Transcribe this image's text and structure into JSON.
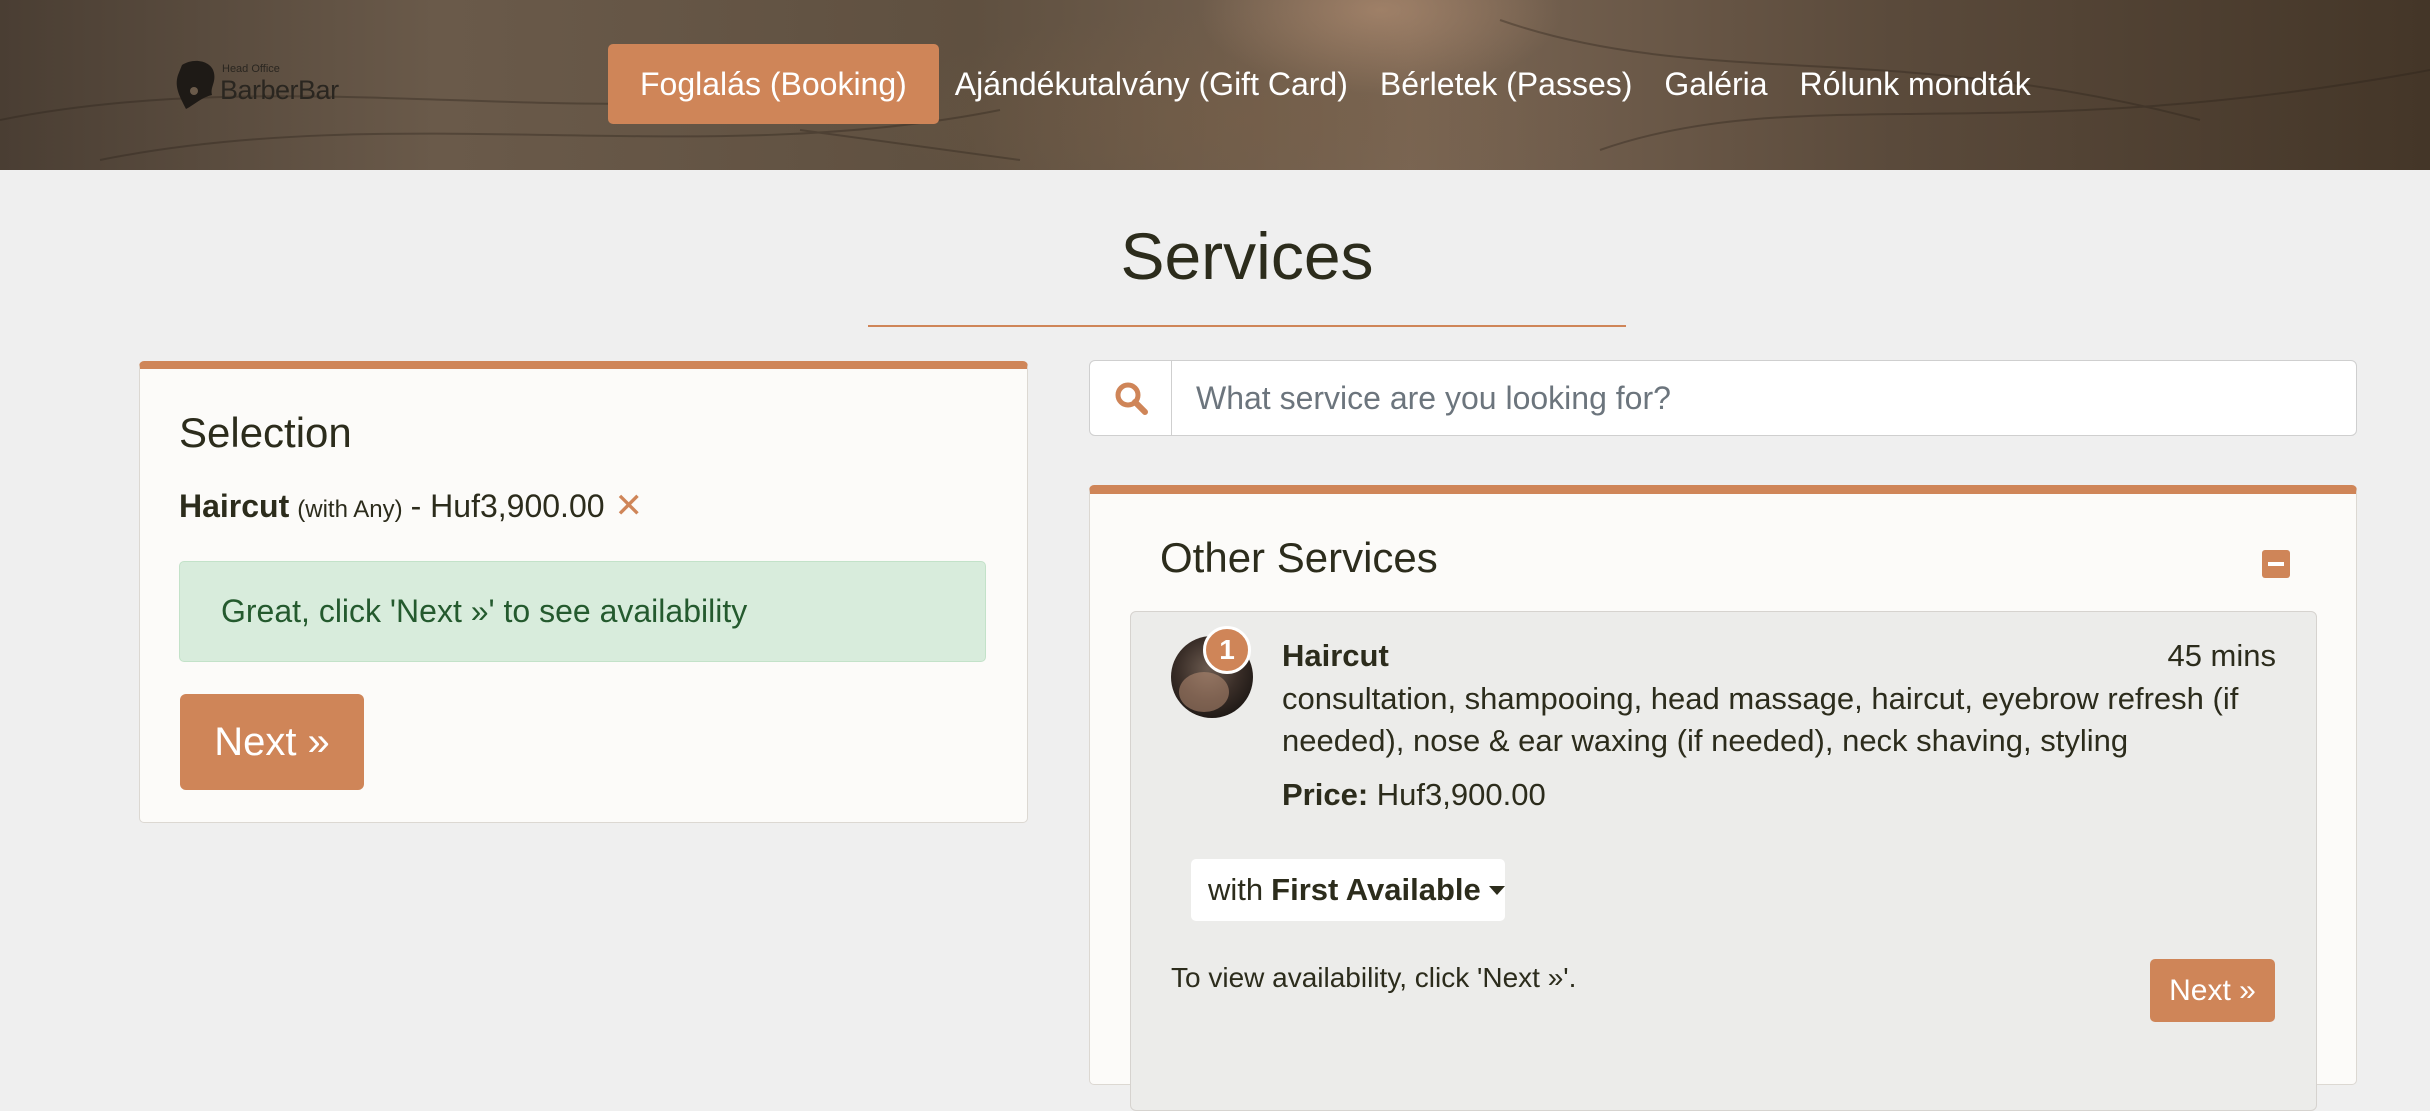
{
  "header": {
    "logo_small": "Head Office",
    "logo_text": "BarberBar",
    "nav": [
      {
        "label": "Foglalás (Booking)",
        "active": true
      },
      {
        "label": "Ajándékutalvány (Gift Card)",
        "active": false
      },
      {
        "label": "Bérletek (Passes)",
        "active": false
      },
      {
        "label": "Galéria",
        "active": false
      },
      {
        "label": "Rólunk mondták",
        "active": false
      }
    ]
  },
  "page": {
    "title": "Services"
  },
  "selection": {
    "title": "Selection",
    "item_name": "Haircut",
    "item_with": "(with Any)",
    "item_price": "- Huf3,900.00",
    "alert_text": "Great, click 'Next »' to see availability",
    "next_label": "Next »"
  },
  "search": {
    "placeholder": "What service are you looking for?",
    "icon": "search-icon"
  },
  "other_services": {
    "title": "Other Services",
    "services": [
      {
        "badge": "1",
        "name": "Haircut",
        "duration": "45 mins",
        "description": "consultation, shampooing, head massage, haircut, eyebrow refresh (if needed), nose & ear waxing (if needed), neck shaving, styling",
        "price_label": "Price:",
        "price": "Huf3,900.00",
        "staff_prefix": "with",
        "staff_value": "First Available",
        "hint": "To view availability, click 'Next »'.",
        "next_label": "Next »"
      }
    ]
  },
  "colors": {
    "accent": "#cf8558",
    "background": "#efefef",
    "alert_bg": "#d8ecdc",
    "alert_text": "#245a2e"
  }
}
